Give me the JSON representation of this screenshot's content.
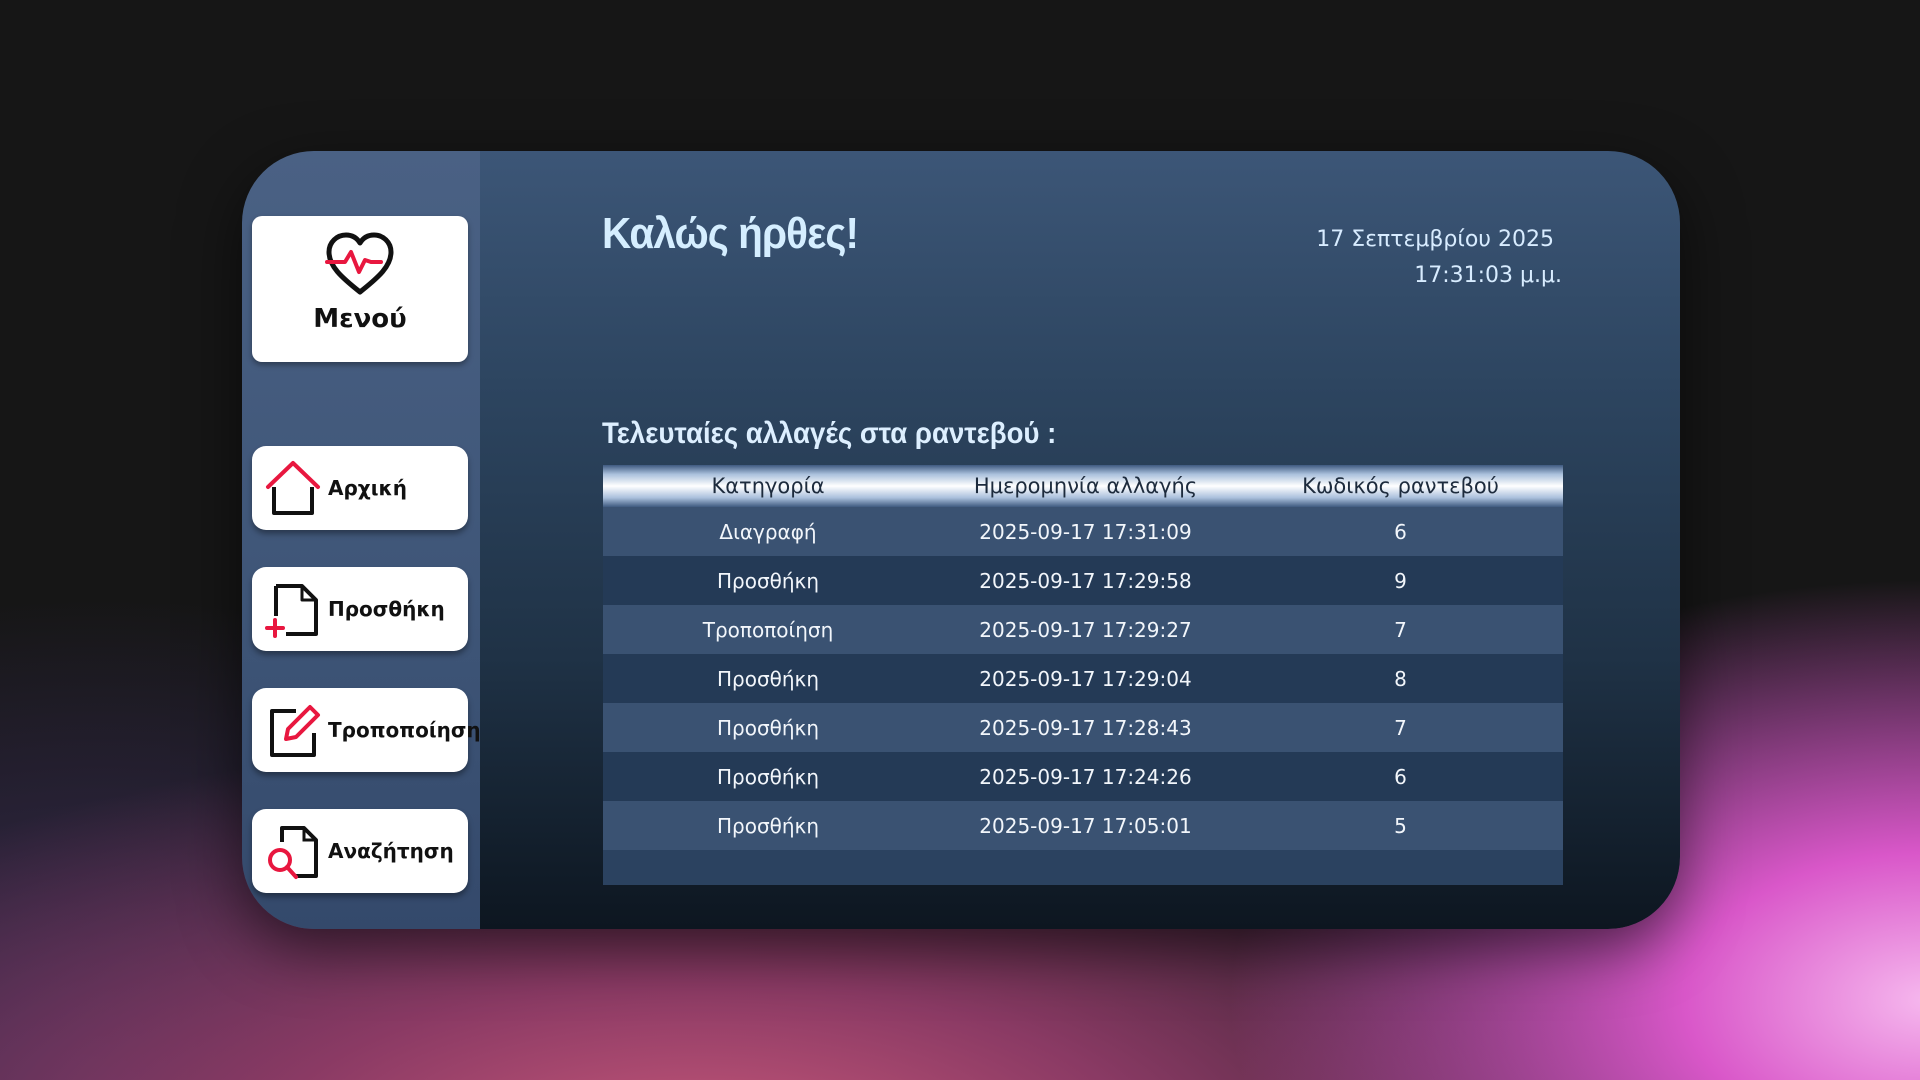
{
  "sidebar": {
    "menu_title": "Μενού",
    "items": [
      {
        "label": "Αρχική",
        "icon": "home-icon"
      },
      {
        "label": "Προσθήκη",
        "icon": "add-document-icon"
      },
      {
        "label": "Τροποποίηση",
        "icon": "edit-icon"
      },
      {
        "label": "Αναζήτηση",
        "icon": "search-document-icon"
      }
    ]
  },
  "header": {
    "welcome": "Καλώς ήρθες!",
    "date": "17 Σεπτεμβρίου 2025",
    "time": "17:31:03 μ.μ."
  },
  "changes": {
    "title": "Τελευταίες αλλαγές στα ραντεβού :",
    "columns": [
      "Κατηγορία",
      "Ημερομηνία αλλαγής",
      "Κωδικός ραντεβού"
    ],
    "rows": [
      [
        "Διαγραφή",
        "2025-09-17 17:31:09",
        "6"
      ],
      [
        "Προσθήκη",
        "2025-09-17 17:29:58",
        "9"
      ],
      [
        "Τροποποίηση",
        "2025-09-17 17:29:27",
        "7"
      ],
      [
        "Προσθήκη",
        "2025-09-17 17:29:04",
        "8"
      ],
      [
        "Προσθήκη",
        "2025-09-17 17:28:43",
        "7"
      ],
      [
        "Προσθήκη",
        "2025-09-17 17:24:26",
        "6"
      ],
      [
        "Προσθήκη",
        "2025-09-17 17:05:01",
        "5"
      ]
    ]
  },
  "colors": {
    "accent": "#e8173f",
    "sidebar": "#4a6184",
    "title_text": "#d5eeff"
  }
}
